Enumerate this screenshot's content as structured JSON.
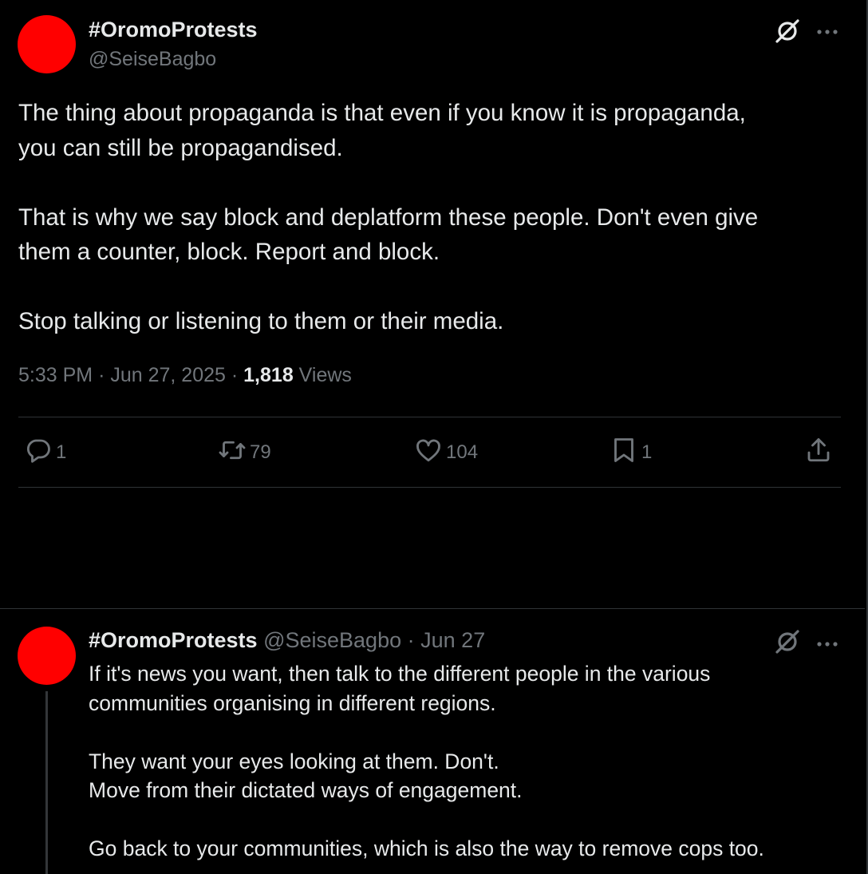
{
  "main_tweet": {
    "display_name": "#OromoProtests",
    "handle": "@SeiseBagbo",
    "avatar_color": "#ff0000",
    "text_lines": [
      "The thing about propaganda is that even if you know it is propaganda,",
      "you can still be propagandised.",
      "",
      "That is why we say block and deplatform these people. Don't even give",
      "them a counter, block. Report and block.",
      "",
      "Stop talking or listening to them or their media."
    ],
    "time": "5:33 PM",
    "date": "Jun 27, 2025",
    "separator": "·",
    "views_count": "1,818",
    "views_label": "Views",
    "actions": {
      "reply_count": "1",
      "repost_count": "79",
      "like_count": "104",
      "bookmark_count": "1"
    }
  },
  "reply_tweet": {
    "display_name": "#OromoProtests",
    "handle": "@SeiseBagbo",
    "separator": "·",
    "date": "Jun 27",
    "avatar_color": "#ff0000",
    "text_lines": [
      "If it's news you want, then talk to the different people in the various",
      "communities organising in different regions.",
      "",
      "They want your eyes looking at them. Don't.",
      "Move from their dictated ways of engagement.",
      "",
      "Go back to your communities, which is also the way to remove cops too."
    ]
  },
  "colors": {
    "background": "#000000",
    "text_primary": "#e7e9ea",
    "text_secondary": "#71767b",
    "divider": "#2f3336"
  },
  "icons": {
    "grok": "grok-icon",
    "more": "more-icon",
    "reply": "reply-icon",
    "repost": "repost-icon",
    "like": "heart-icon",
    "bookmark": "bookmark-icon",
    "share": "share-icon"
  }
}
